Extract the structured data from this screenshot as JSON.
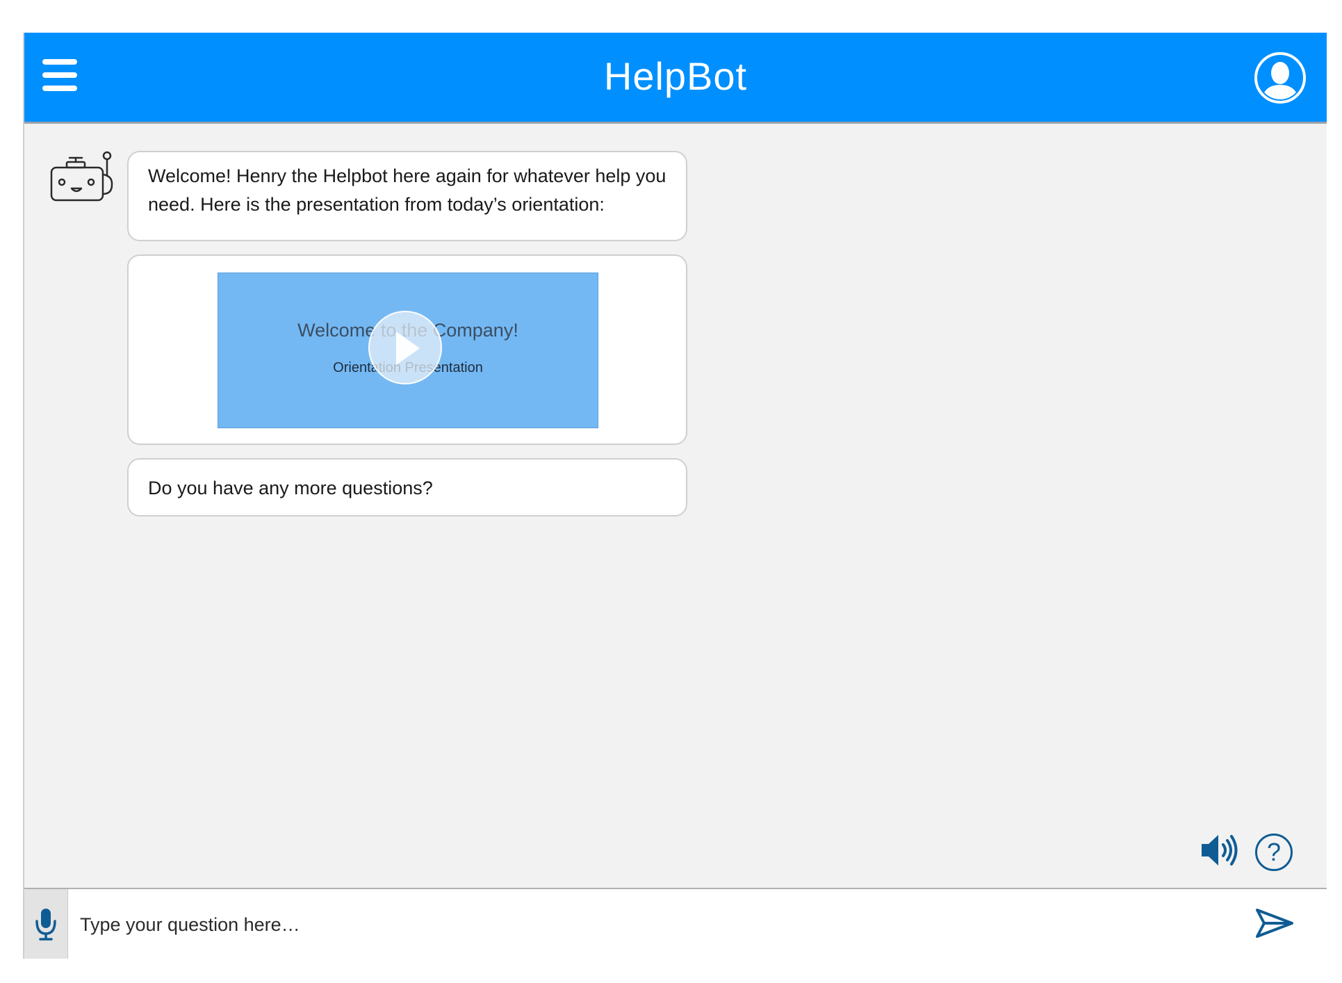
{
  "header": {
    "title": "HelpBot",
    "menu_icon": "hamburger-menu-icon",
    "profile_icon": "user-profile-icon",
    "color": "#008ffe"
  },
  "chat": {
    "bot_avatar_icon": "robot-icon",
    "messages": [
      {
        "text": "Welcome! Henry the Helpbot here again for whatever help you need. Here is the presentation from today’s orientation:"
      },
      {
        "video": {
          "title": "Welcome to the Company!",
          "subtitle": "Orientation Presentation",
          "play_icon": "play-icon",
          "thumb_color": "#74b8f3"
        }
      },
      {
        "text": "Do you have any more questions?"
      }
    ]
  },
  "controls": {
    "speaker_icon": "speaker-icon",
    "help_label": "?",
    "accent": "#0f5c94"
  },
  "input": {
    "placeholder": "Type your question here…",
    "mic_icon": "microphone-icon",
    "send_icon": "send-icon"
  }
}
